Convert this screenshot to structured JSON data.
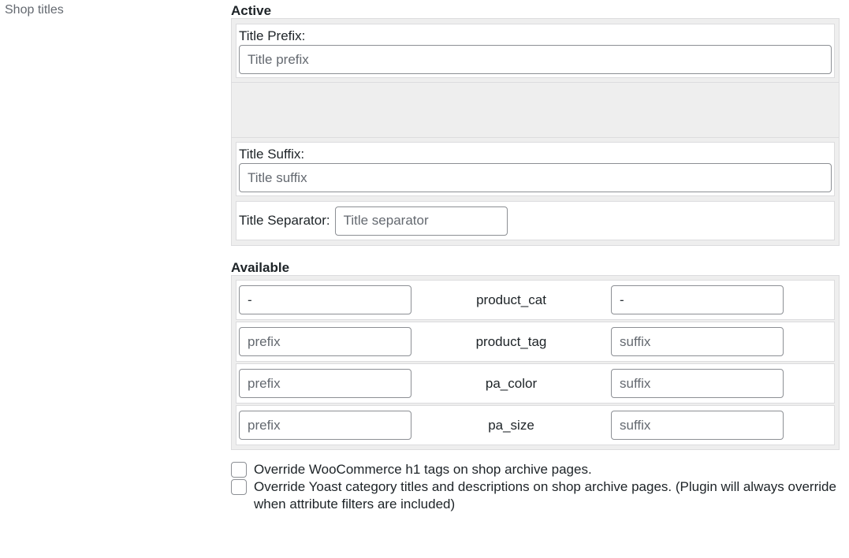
{
  "field_label": "Shop titles",
  "active": {
    "heading": "Active",
    "title_prefix": {
      "label": "Title Prefix:",
      "placeholder": "Title prefix",
      "value": ""
    },
    "title_suffix": {
      "label": "Title Suffix:",
      "placeholder": "Title suffix",
      "value": ""
    },
    "title_separator": {
      "label": "Title Separator:",
      "placeholder": "Title separator",
      "value": ""
    }
  },
  "available": {
    "heading": "Available",
    "rows": [
      {
        "taxonomy": "product_cat",
        "prefix_value": "-",
        "prefix_placeholder": "prefix",
        "suffix_value": "-",
        "suffix_placeholder": "suffix"
      },
      {
        "taxonomy": "product_tag",
        "prefix_value": "",
        "prefix_placeholder": "prefix",
        "suffix_value": "",
        "suffix_placeholder": "suffix"
      },
      {
        "taxonomy": "pa_color",
        "prefix_value": "",
        "prefix_placeholder": "prefix",
        "suffix_value": "",
        "suffix_placeholder": "suffix"
      },
      {
        "taxonomy": "pa_size",
        "prefix_value": "",
        "prefix_placeholder": "prefix",
        "suffix_value": "",
        "suffix_placeholder": "suffix"
      }
    ]
  },
  "options": [
    {
      "label": "Override WooCommerce h1 tags on shop archive pages.",
      "checked": false
    },
    {
      "label": "Override Yoast category titles and descriptions on shop archive pages. (Plugin will always override when attribute filters are included)",
      "checked": false
    }
  ]
}
